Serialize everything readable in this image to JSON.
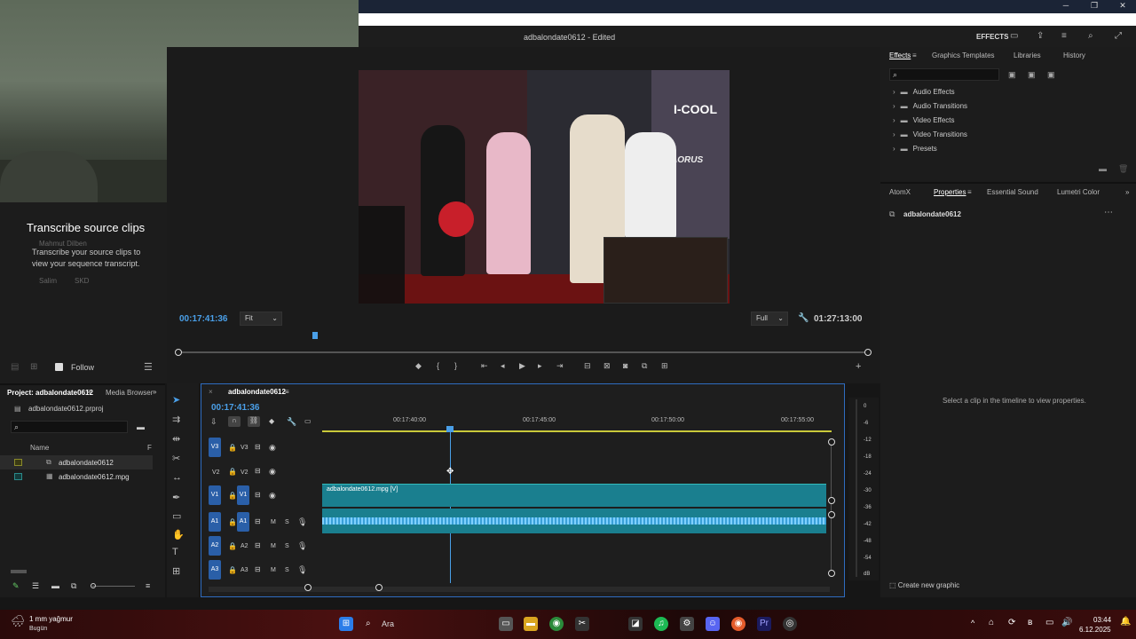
{
  "window": {
    "minimize": "─",
    "maximize": "❐",
    "close": "✕"
  },
  "header": {
    "title": "adbalondate0612 - Edited",
    "effects_label": "EFFECTS"
  },
  "transcribe": {
    "title": "Transcribe source clips",
    "description": "Transcribe your source clips to view your sequence transcript.",
    "ghost1": "Mahmut Dilben",
    "ghost2": "Salim",
    "ghost3": "SKD",
    "follow_label": "Follow"
  },
  "program": {
    "timecode_left": "00:17:41:36",
    "fit_select": "Fit",
    "full_select": "Full",
    "timecode_right": "01:27:13:00",
    "video_logo1": "I-COOL",
    "video_logo2": "AORUS"
  },
  "effects_panel": {
    "tabs": [
      "Effects",
      "Graphics Templates",
      "Libraries",
      "History"
    ],
    "folders": [
      "Audio Effects",
      "Audio Transitions",
      "Video Effects",
      "Video Transitions",
      "Presets"
    ]
  },
  "properties_panel": {
    "tabs": [
      "AtomX",
      "Properties",
      "Essential Sound",
      "Lumetri Color"
    ],
    "clip_name": "adbalondate0612",
    "empty_message": "Select a clip in the timeline to view properties.",
    "create_button": "Create new graphic"
  },
  "project_panel": {
    "tab": "Project: adbalondate0612",
    "tab2": "Media Browser",
    "file": "adbalondate0612.prproj",
    "column_name": "Name",
    "column_f": "F",
    "items": [
      {
        "name": "adbalondate0612",
        "color": "#8a8a2a"
      },
      {
        "name": "adbalondate0612.mpg",
        "color": "#2a8a8a"
      }
    ]
  },
  "timeline": {
    "tab": "adbalondate0612",
    "timecode": "00:17:41:36",
    "ruler_labels": [
      "00:17:40:00",
      "00:17:45:00",
      "00:17:50:00",
      "00:17:55:00"
    ],
    "video_tracks": [
      "V3",
      "V2",
      "V1"
    ],
    "audio_tracks": [
      "A1",
      "A2",
      "A3"
    ],
    "clip_label": "adbalondate0612.mpg [V]",
    "mute": "M",
    "solo": "S"
  },
  "meter": {
    "labels": [
      "0",
      "-6",
      "-12",
      "-18",
      "-24",
      "-30",
      "-36",
      "-42",
      "-48",
      "-54",
      "dB"
    ]
  },
  "taskbar": {
    "weather_title": "1 mm yağmur",
    "weather_sub": "Bugün",
    "search_label": "Ara",
    "time": "03:44",
    "date": "6.12.2025"
  },
  "colors": {
    "accent": "#2d8ceb",
    "clip_teal": "#1a7f8f",
    "audio_blue": "#4aa8e8"
  }
}
